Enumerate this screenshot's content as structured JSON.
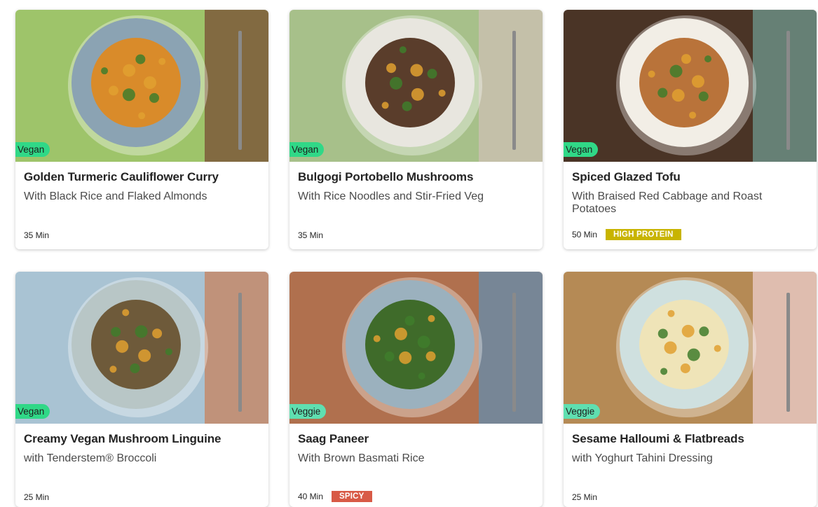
{
  "recipes": [
    {
      "title": "Golden Turmeric Cauliflower Curry",
      "subtitle": "With Black Rice and Flaked Almonds",
      "time": "35 Min",
      "badge": "Vegan",
      "tag": "",
      "bg": "#9ec46a",
      "bg2": "#7d5b3a",
      "plate": "#8ba3b3",
      "food": "#d98b2a"
    },
    {
      "title": "Bulgogi Portobello Mushrooms",
      "subtitle": "With Rice Noodles and Stir-Fried Veg",
      "time": "35 Min",
      "badge": "Vegan",
      "tag": "",
      "bg": "#a7c08a",
      "bg2": "#c9c0ae",
      "plate": "#e8e6df",
      "food": "#5a3d2b"
    },
    {
      "title": "Spiced Glazed Tofu",
      "subtitle": "With Braised Red Cabbage and Roast Potatoes",
      "time": "50 Min",
      "badge": "Vegan",
      "tag": "HIGH PROTEIN",
      "tagType": "protein",
      "bg": "#4a3426",
      "bg2": "#6b8e84",
      "plate": "#f2eee6",
      "food": "#b9733a"
    },
    {
      "title": "Creamy Vegan Mushroom Linguine",
      "subtitle": "with Tenderstem® Broccoli",
      "time": "25 Min",
      "badge": "Vegan",
      "tag": "",
      "bg": "#a9c3d3",
      "bg2": "#c48a6a",
      "plate": "#b8c6c6",
      "food": "#6e5a3a"
    },
    {
      "title": "Saag Paneer",
      "subtitle": "With Brown Basmati Rice",
      "time": "40 Min",
      "badge": "Veggie",
      "tag": "SPICY",
      "tagType": "spicy",
      "bg": "#b0704e",
      "bg2": "#6d89a3",
      "plate": "#9bb1be",
      "food": "#3f6b2a"
    },
    {
      "title": "Sesame Halloumi & Flatbreads",
      "subtitle": "with Yoghurt Tahini Dressing",
      "time": "25 Min",
      "badge": "Veggie",
      "tag": "",
      "bg": "#b58a55",
      "bg2": "#e6c6c0",
      "plate": "#cfe0df",
      "food": "#efe4b8"
    }
  ]
}
